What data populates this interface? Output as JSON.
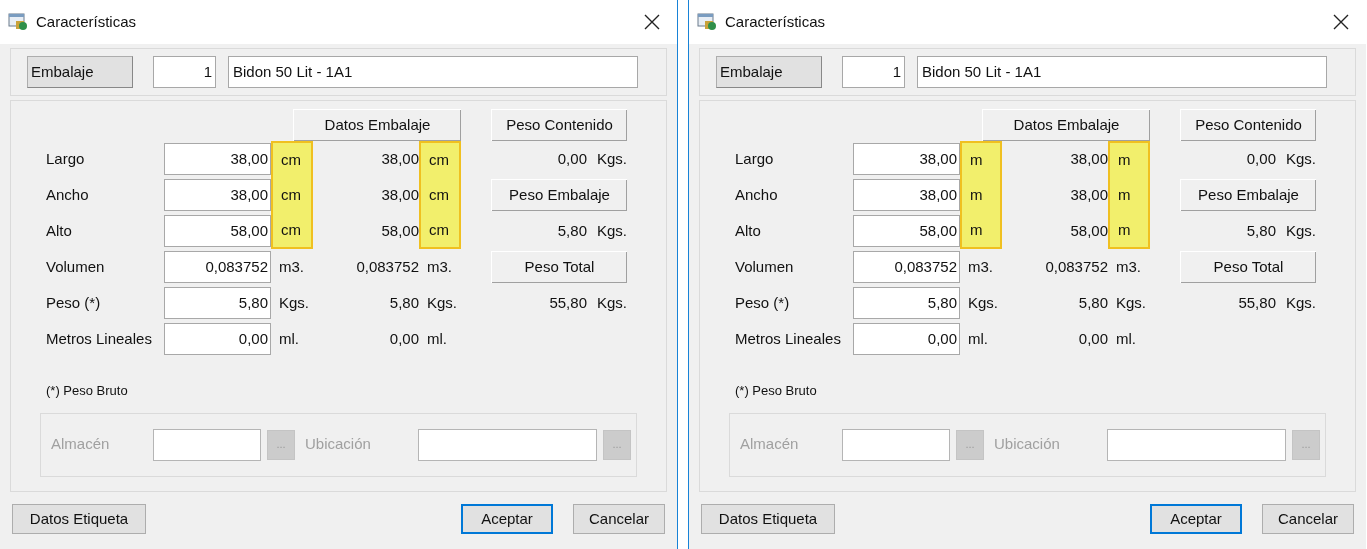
{
  "dialogs": [
    {
      "title": "Características",
      "header": {
        "button": "Embalaje",
        "number": "1",
        "name": "Bidon 50 Lit - 1A1"
      },
      "data_header": "Datos Embalaje",
      "rows": [
        {
          "label": "Largo",
          "value": "38,00",
          "unit": "cm",
          "highlighted": true,
          "data_value": "38,00",
          "data_unit": "cm",
          "data_highlighted": true
        },
        {
          "label": "Ancho",
          "value": "38,00",
          "unit": "cm",
          "highlighted": true,
          "data_value": "38,00",
          "data_unit": "cm",
          "data_highlighted": true
        },
        {
          "label": "Alto",
          "value": "58,00",
          "unit": "cm",
          "highlighted": true,
          "data_value": "58,00",
          "data_unit": "cm",
          "data_highlighted": true
        },
        {
          "label": "Volumen",
          "value": "0,083752",
          "unit": "m3.",
          "highlighted": false,
          "data_value": "0,083752",
          "data_unit": "m3.",
          "data_highlighted": false
        },
        {
          "label": "Peso (*)",
          "value": "5,80",
          "unit": "Kgs.",
          "highlighted": false,
          "data_value": "5,80",
          "data_unit": "Kgs.",
          "data_highlighted": false
        },
        {
          "label": "Metros Lineales",
          "value": "0,00",
          "unit": "ml.",
          "highlighted": false,
          "data_value": "0,00",
          "data_unit": "ml.",
          "data_highlighted": false
        }
      ],
      "weights": [
        {
          "kind": "header",
          "text": "Peso Contenido"
        },
        {
          "kind": "value",
          "value": "0,00",
          "unit": "Kgs."
        },
        {
          "kind": "header",
          "text": "Peso Embalaje"
        },
        {
          "kind": "value",
          "value": "5,80",
          "unit": "Kgs."
        },
        {
          "kind": "header",
          "text": "Peso Total"
        },
        {
          "kind": "value",
          "value": "55,80",
          "unit": "Kgs."
        }
      ],
      "note": "(*) Peso Bruto",
      "location": [
        {
          "label": "Almacén",
          "browse": "...",
          "disabled": true
        },
        {
          "label": "Ubicación",
          "browse": "...",
          "disabled": true
        }
      ],
      "buttons": [
        {
          "label": "Datos Etiqueta",
          "default": false
        },
        {
          "label": "Aceptar",
          "default": true
        },
        {
          "label": "Cancelar",
          "default": false
        }
      ]
    },
    {
      "title": "Características",
      "header": {
        "button": "Embalaje",
        "number": "1",
        "name": "Bidon 50 Lit - 1A1"
      },
      "data_header": "Datos Embalaje",
      "rows": [
        {
          "label": "Largo",
          "value": "38,00",
          "unit": "m",
          "highlighted": true,
          "data_value": "38,00",
          "data_unit": "m",
          "data_highlighted": true
        },
        {
          "label": "Ancho",
          "value": "38,00",
          "unit": "m",
          "highlighted": true,
          "data_value": "38,00",
          "data_unit": "m",
          "data_highlighted": true
        },
        {
          "label": "Alto",
          "value": "58,00",
          "unit": "m",
          "highlighted": true,
          "data_value": "58,00",
          "data_unit": "m",
          "data_highlighted": true
        },
        {
          "label": "Volumen",
          "value": "0,083752",
          "unit": "m3.",
          "highlighted": false,
          "data_value": "0,083752",
          "data_unit": "m3.",
          "data_highlighted": false
        },
        {
          "label": "Peso (*)",
          "value": "5,80",
          "unit": "Kgs.",
          "highlighted": false,
          "data_value": "5,80",
          "data_unit": "Kgs.",
          "data_highlighted": false
        },
        {
          "label": "Metros Lineales",
          "value": "0,00",
          "unit": "ml.",
          "highlighted": false,
          "data_value": "0,00",
          "data_unit": "ml.",
          "data_highlighted": false
        }
      ],
      "weights": [
        {
          "kind": "header",
          "text": "Peso Contenido"
        },
        {
          "kind": "value",
          "value": "0,00",
          "unit": "Kgs."
        },
        {
          "kind": "header",
          "text": "Peso Embalaje"
        },
        {
          "kind": "value",
          "value": "5,80",
          "unit": "Kgs."
        },
        {
          "kind": "header",
          "text": "Peso Total"
        },
        {
          "kind": "value",
          "value": "55,80",
          "unit": "Kgs."
        }
      ],
      "note": "(*) Peso Bruto",
      "location": [
        {
          "label": "Almacén",
          "browse": "...",
          "disabled": true
        },
        {
          "label": "Ubicación",
          "browse": "...",
          "disabled": true
        }
      ],
      "buttons": [
        {
          "label": "Datos Etiqueta",
          "default": false
        },
        {
          "label": "Aceptar",
          "default": true
        },
        {
          "label": "Cancelar",
          "default": false
        }
      ]
    }
  ]
}
